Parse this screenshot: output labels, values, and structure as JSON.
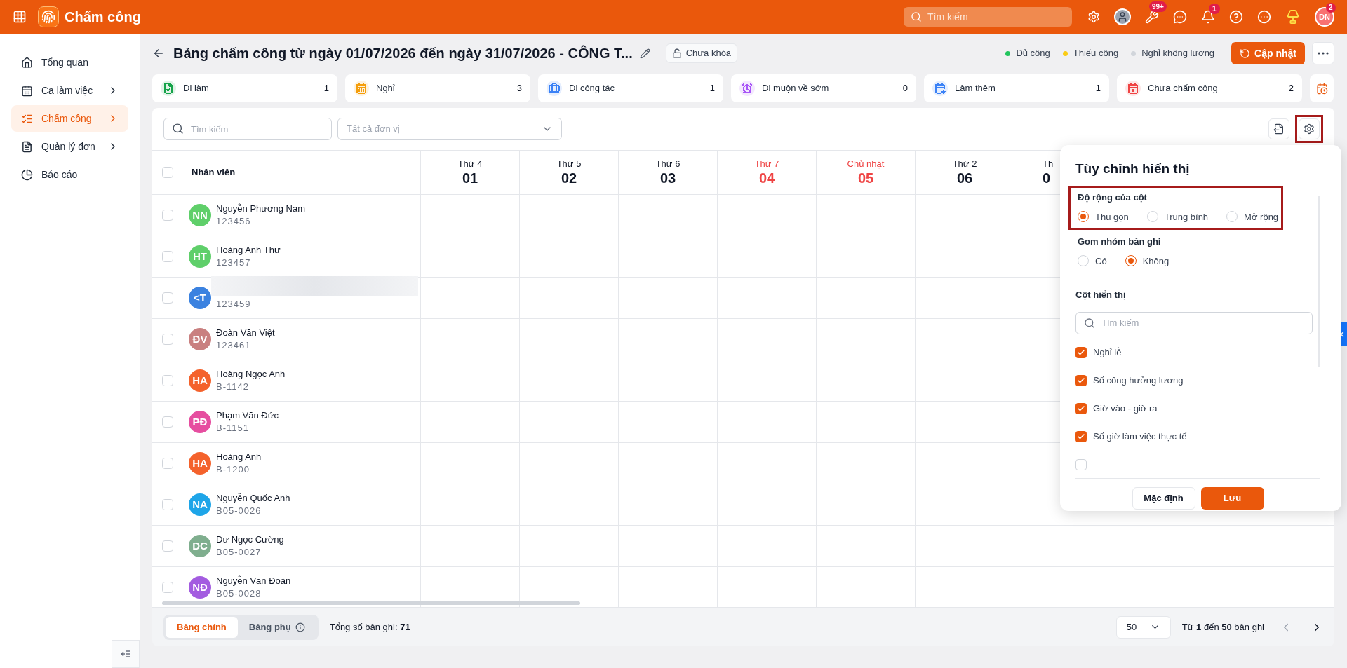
{
  "app": {
    "title": "Chấm công"
  },
  "topbar": {
    "search_placeholder": "Tìm kiếm",
    "tools_badge": "99+",
    "bell_badge": "1",
    "avatar_initials": "DN",
    "avatar_badge": "2"
  },
  "sidebar": {
    "items": [
      {
        "label": "Tổng quan",
        "has_children": false,
        "selected": false
      },
      {
        "label": "Ca làm việc",
        "has_children": true,
        "selected": false
      },
      {
        "label": "Chấm công",
        "has_children": true,
        "selected": true
      },
      {
        "label": "Quản lý đơn",
        "has_children": true,
        "selected": false
      },
      {
        "label": "Báo cáo",
        "has_children": false,
        "selected": false
      }
    ]
  },
  "header": {
    "title": "Bảng chấm công từ ngày 01/07/2026 đến ngày 31/07/2026 - CÔNG T...",
    "lock_label": "Chưa khóa",
    "update_button": "Cập nhật",
    "legend": [
      {
        "label": "Đủ công",
        "color": "#22c55e"
      },
      {
        "label": "Thiếu công",
        "color": "#facc15"
      },
      {
        "label": "Nghỉ không lương",
        "color": "#d1d5db"
      }
    ]
  },
  "summary_cards": [
    {
      "label": "Đi làm",
      "count": "1",
      "color": "#16a34a"
    },
    {
      "label": "Nghỉ",
      "count": "3",
      "color": "#f59e0b"
    },
    {
      "label": "Đi công tác",
      "count": "1",
      "color": "#3b82f6"
    },
    {
      "label": "Đi muộn về sớm",
      "count": "0",
      "color": "#a855f7"
    },
    {
      "label": "Làm thêm",
      "count": "1",
      "color": "#3b82f6"
    },
    {
      "label": "Chưa chấm công",
      "count": "2",
      "color": "#ef4444"
    }
  ],
  "toolbar": {
    "search_placeholder": "Tìm kiếm",
    "unit_placeholder": "Tất cả đơn vị",
    "settings_highlighted": true
  },
  "table": {
    "employee_column": "Nhân viên",
    "all_checked": false,
    "days": [
      {
        "weekday": "Thứ 4",
        "date": "01",
        "weekend": false
      },
      {
        "weekday": "Thứ 5",
        "date": "02",
        "weekend": false
      },
      {
        "weekday": "Thứ 6",
        "date": "03",
        "weekend": false
      },
      {
        "weekday": "Thứ 7",
        "date": "04",
        "weekend": true
      },
      {
        "weekday": "Chủ nhật",
        "date": "05",
        "weekend": true
      },
      {
        "weekday": "Thứ 2",
        "date": "06",
        "weekend": false
      },
      {
        "weekday": "Th",
        "date": "0",
        "weekend": false
      }
    ],
    "rows": [
      {
        "name": "Nguyễn Phương Nam",
        "code": "123456",
        "initials": "NN",
        "color": "#5fcf6a",
        "checked": false
      },
      {
        "name": "Hoàng Anh Thư",
        "code": "123457",
        "initials": "HT",
        "color": "#5fcf6a",
        "checked": false
      },
      {
        "code": "123459",
        "initials": "<T",
        "color": "#3b82e0",
        "checked": false
      },
      {
        "name": "Đoàn Văn Việt",
        "code": "123461",
        "initials": "ĐV",
        "color": "#c98080",
        "checked": false
      },
      {
        "name": "Hoàng Ngọc Anh",
        "code": "B-1142",
        "initials": "HA",
        "color": "#f4622c",
        "checked": false
      },
      {
        "name": "Phạm Văn Đức",
        "code": "B-1151",
        "initials": "PĐ",
        "color": "#e64ea0",
        "checked": false
      },
      {
        "name": "Hoàng Anh",
        "code": "B-1200",
        "initials": "HA",
        "color": "#f4622c",
        "checked": false
      },
      {
        "name": "Nguyễn Quốc Anh",
        "code": "B05-0026",
        "initials": "NA",
        "color": "#1ea5e8",
        "checked": false
      },
      {
        "name": "Dư Ngọc Cường",
        "code": "B05-0027",
        "initials": "DC",
        "color": "#7fae8e",
        "checked": false
      },
      {
        "name": "Nguyễn Văn Đoàn",
        "code": "B05-0028",
        "initials": "NĐ",
        "color": "#a35ce0",
        "checked": false
      }
    ]
  },
  "settings_panel": {
    "title": "Tùy chỉnh hiển thị",
    "groups": [
      {
        "label": "Độ rộng của cột",
        "highlighted": true,
        "options": [
          {
            "label": "Thu gọn",
            "selected": true
          },
          {
            "label": "Trung bình",
            "selected": false
          },
          {
            "label": "Mở rộng",
            "selected": false
          }
        ]
      },
      {
        "label": "Gom nhóm bản ghi",
        "highlighted": false,
        "options": [
          {
            "label": "Có",
            "selected": false
          },
          {
            "label": "Không",
            "selected": true
          }
        ]
      }
    ],
    "columns_label": "Cột hiển thị",
    "search_placeholder": "Tìm kiếm",
    "columns": [
      {
        "label": "Nghỉ lễ",
        "checked": true
      },
      {
        "label": "Số công hưởng lương",
        "checked": true
      },
      {
        "label": "Giờ vào - giờ ra",
        "checked": true
      },
      {
        "label": "Số giờ làm việc thực tế",
        "checked": true
      },
      {
        "checked": false
      }
    ],
    "default_button": "Mặc định",
    "save_button": "Lưu"
  },
  "footer": {
    "tabs": [
      {
        "label": "Bảng chính",
        "selected": true,
        "info": false
      },
      {
        "label": "Bảng phụ",
        "selected": false,
        "info": true
      }
    ],
    "total": "Tổng số bản ghi: **71**",
    "page_size": "50",
    "range": "Từ **1** đến **50** bản ghi"
  }
}
